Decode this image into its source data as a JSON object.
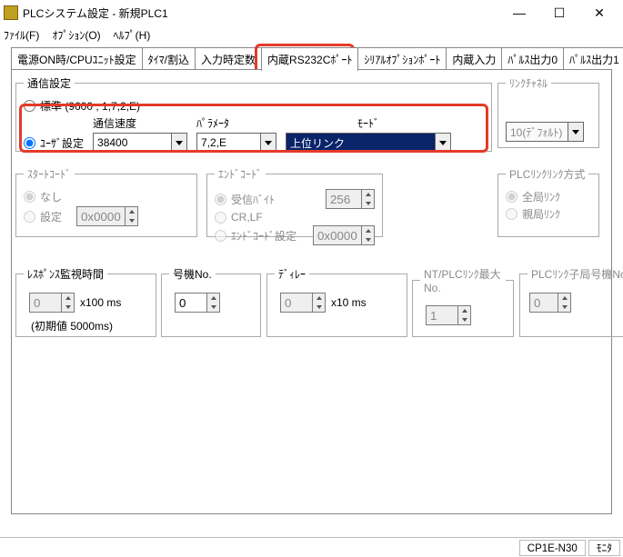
{
  "window": {
    "title": "PLCシステム設定 - 新規PLC1"
  },
  "menu": {
    "file": "ﾌｧｲﾙ(F)",
    "option": "ｵﾌﾟｼｮﾝ(O)",
    "help": "ﾍﾙﾌﾟ(H)"
  },
  "tabs": {
    "t1": "電源ON時/CPUﾕﾆｯﾄ設定",
    "t2": "ﾀｲﾏ/割込",
    "t3": "入力時定数",
    "t4": "内蔵RS232Cﾎﾟｰﾄ",
    "t5": "ｼﾘｱﾙｵﾌﾟｼｮﾝﾎﾟｰﾄ",
    "t6": "内蔵入力",
    "t7": "ﾊﾟﾙｽ出力0",
    "t8": "ﾊﾟﾙｽ出力1"
  },
  "comm": {
    "legend": "通信設定",
    "standard": "標準 (9600 ; 1,7,2,E)",
    "user": "ﾕｰｻﾞ設定",
    "speed_label": "通信速度",
    "speed_value": "38400",
    "param_label": "ﾊﾟﾗﾒｰﾀ",
    "param_value": "7,2,E",
    "mode_label": "ﾓｰﾄﾞ",
    "mode_value": "上位リンク"
  },
  "linkch": {
    "legend": "ﾘﾝｸﾁｬﾈﾙ",
    "value": "10(ﾃﾞﾌｫﾙﾄ)"
  },
  "start": {
    "legend": "ｽﾀｰﾄｺｰﾄﾞ",
    "none": "なし",
    "set": "設定",
    "value": "0x0000"
  },
  "end": {
    "legend": "ｴﾝﾄﾞｺｰﾄﾞ",
    "recvbyte": "受信ﾊﾞｲﾄ",
    "recv_value": "256",
    "crlf": "CR,LF",
    "endset": "ｴﾝﾄﾞｺｰﾄﾞ設定",
    "end_value": "0x0000"
  },
  "plclink": {
    "legend": "PLCﾘﾝｸﾘﾝｸ方式",
    "all": "全局ﾘﾝｸ",
    "master": "親局ﾘﾝｸ"
  },
  "resp": {
    "legend": "ﾚｽﾎﾟﾝｽ監視時間",
    "value": "0",
    "unit": "x100 ms",
    "default": "(初期値 5000ms)"
  },
  "unit": {
    "legend": "号機No.",
    "value": "0"
  },
  "delay": {
    "legend": "ﾃﾞｨﾚｰ",
    "value": "0",
    "unit": "x10 ms"
  },
  "nt": {
    "legend": "NT/PLCﾘﾝｸ最大No.",
    "value": "1"
  },
  "plclinkno": {
    "legend": "PLCﾘﾝｸ子局号機No.",
    "value": "0"
  },
  "status": {
    "model": "CP1E-N30",
    "mode": "ﾓﾆﾀ"
  }
}
